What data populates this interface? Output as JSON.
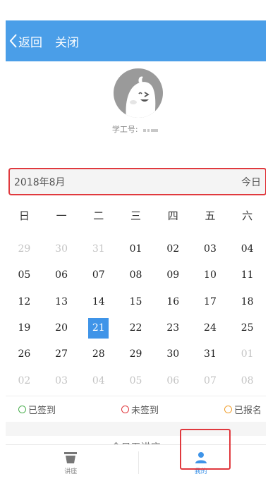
{
  "nav": {
    "back_label": "返回",
    "close_label": "关闭"
  },
  "profile": {
    "student_id_label": "学工号:"
  },
  "calendar": {
    "month_label": "2018年8月",
    "today_label": "今日",
    "weekdays": [
      "日",
      "一",
      "二",
      "三",
      "四",
      "五",
      "六"
    ],
    "selected_day": "21",
    "weeks": [
      [
        {
          "d": "29",
          "dim": true
        },
        {
          "d": "30",
          "dim": true
        },
        {
          "d": "31",
          "dim": true
        },
        {
          "d": "01"
        },
        {
          "d": "02"
        },
        {
          "d": "03"
        },
        {
          "d": "04"
        }
      ],
      [
        {
          "d": "05"
        },
        {
          "d": "06"
        },
        {
          "d": "07"
        },
        {
          "d": "08"
        },
        {
          "d": "09"
        },
        {
          "d": "10"
        },
        {
          "d": "11"
        }
      ],
      [
        {
          "d": "12"
        },
        {
          "d": "13"
        },
        {
          "d": "14"
        },
        {
          "d": "15"
        },
        {
          "d": "16"
        },
        {
          "d": "17"
        },
        {
          "d": "18"
        }
      ],
      [
        {
          "d": "19"
        },
        {
          "d": "20"
        },
        {
          "d": "21",
          "selected": true
        },
        {
          "d": "22"
        },
        {
          "d": "23"
        },
        {
          "d": "24"
        },
        {
          "d": "25"
        }
      ],
      [
        {
          "d": "26"
        },
        {
          "d": "27"
        },
        {
          "d": "28"
        },
        {
          "d": "29"
        },
        {
          "d": "30"
        },
        {
          "d": "31"
        },
        {
          "d": "01",
          "dim": true
        }
      ],
      [
        {
          "d": "02",
          "dim": true
        },
        {
          "d": "03",
          "dim": true
        },
        {
          "d": "04",
          "dim": true
        },
        {
          "d": "05",
          "dim": true
        },
        {
          "d": "06",
          "dim": true
        },
        {
          "d": "07",
          "dim": true
        },
        {
          "d": "08",
          "dim": true
        }
      ]
    ]
  },
  "legend": [
    {
      "label": "已签到",
      "color": "#4caf50"
    },
    {
      "label": "未签到",
      "color": "#e0393e"
    },
    {
      "label": "已报名",
      "color": "#f0a030"
    }
  ],
  "empty_note": "今日无讲座",
  "tabs": [
    {
      "label": "讲座",
      "icon": "trash-can-icon",
      "active": false
    },
    {
      "label": "我的",
      "icon": "person-icon",
      "active": true
    }
  ],
  "colors": {
    "accent": "#4a9ee8",
    "selected": "#3f94e8",
    "highlight_border": "#e0393e"
  }
}
